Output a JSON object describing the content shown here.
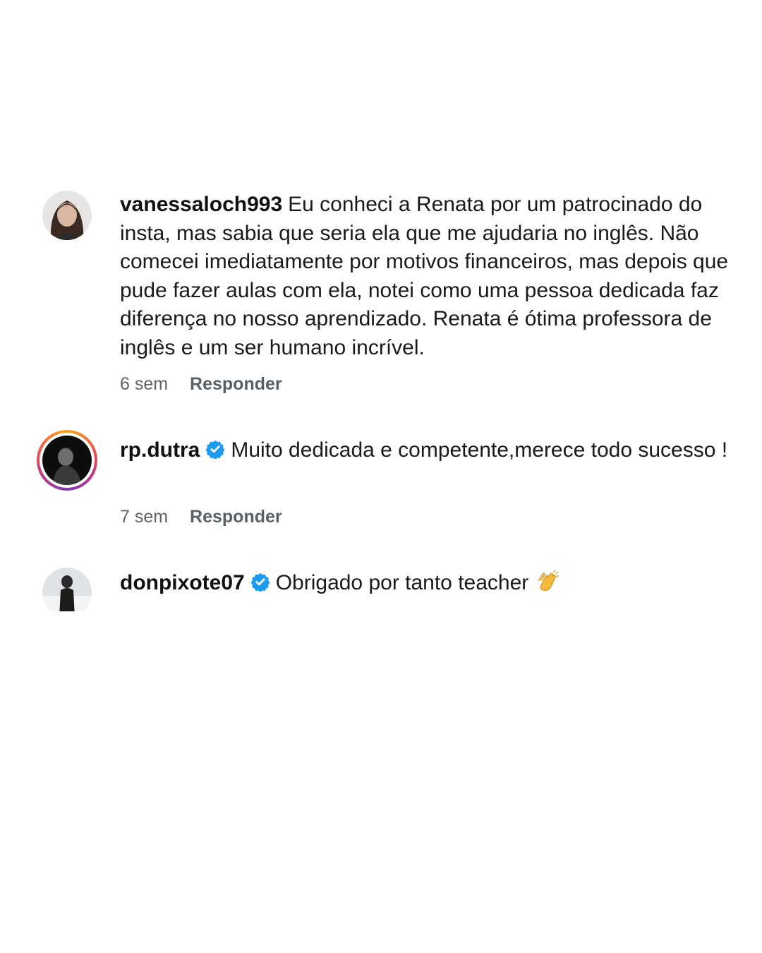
{
  "comments": [
    {
      "username": "vanessaloch993",
      "text": "Eu conheci a Renata por um patrocinado do insta, mas sabia que seria ela que me ajudaria no inglês. Não comecei imediatamente por motivos financeiros, mas depois que pude fazer aulas com ela, notei como uma pessoa dedicada faz diferença no nosso aprendizado. Renata é ótima professora de inglês e um ser humano incrível.",
      "time": "6 sem",
      "reply_label": "Responder",
      "verified": false
    },
    {
      "username": "rp.dutra",
      "text": "Muito dedicada e competente,merece todo sucesso !",
      "time": "7 sem",
      "reply_label": "Responder",
      "verified": true,
      "has_story_ring": true
    },
    {
      "username": "donpixote07",
      "text": "Obrigado por tanto teacher",
      "verified": true,
      "emoji": "clapping-hands-icon"
    }
  ],
  "colors": {
    "verified_badge": "#1d9bf0",
    "meta_text": "#5f6368"
  }
}
